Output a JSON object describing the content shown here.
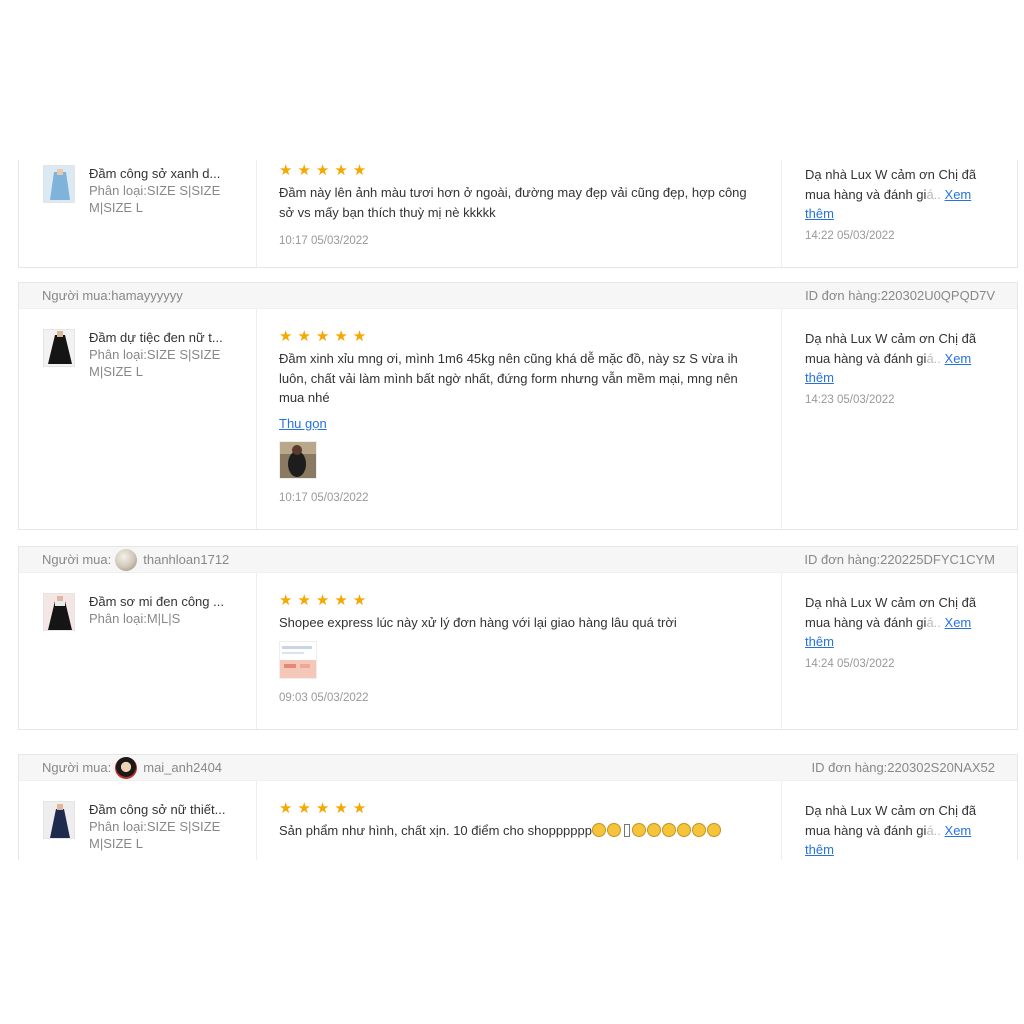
{
  "reviews": [
    {
      "buyer_label": "",
      "buyer_name": "",
      "order_label": "",
      "order_id": "",
      "product_name": "Đầm công sở xanh d...",
      "variant": "Phân loại:SIZE S|SIZE M|SIZE L",
      "stars": "★★★★★",
      "text": "Đầm này lên ảnh màu tươi hơn ở ngoài, đường may đẹp vải cũng đẹp, hợp công sở vs mấy bạn thích thuỳ mị nè kkkkk",
      "review_time": "10:17 05/03/2022",
      "reply": "Dạ nhà Lux W cảm ơn Chị đã mua hàng và đánh gi",
      "reply_fade": "á..",
      "more_label": "Xem thêm",
      "reply_time": "14:22 05/03/2022"
    },
    {
      "buyer_label": "Người mua:",
      "buyer_name": "hamayyyyyy",
      "order_label": "ID đơn hàng:",
      "order_id": "220302U0QPQD7V",
      "product_name": "Đầm dự tiệc đen nữ t...",
      "variant": "Phân loại:SIZE S|SIZE M|SIZE L",
      "stars": "★★★★★",
      "text": "Đầm xinh xỉu mng ơi, mình 1m6 45kg nên cũng khá dễ mặc đồ, này sz S vừa ih luôn, chất vải làm mình bất ngờ nhất, đứng form nhưng vẫn mềm mại, mng nên mua nhé",
      "collapse_label": "Thu gọn",
      "review_time": "10:17 05/03/2022",
      "reply": "Dạ nhà Lux W cảm ơn Chị đã mua hàng và đánh gi",
      "reply_fade": "á..",
      "more_label": "Xem thêm",
      "reply_time": "14:23 05/03/2022"
    },
    {
      "buyer_label": "Người mua:",
      "buyer_name": "thanhloan1712",
      "order_label": "ID đơn hàng:",
      "order_id": "220225DFYC1CYM",
      "product_name": "Đầm sơ mi đen công ...",
      "variant": "Phân loại:M|L|S",
      "stars": "★★★★★",
      "text": "Shopee express lúc này xử lý đơn hàng với lại giao hàng lâu quá trời",
      "review_time": "09:03 05/03/2022",
      "reply": "Dạ nhà Lux W cảm ơn Chị đã mua hàng và đánh gi",
      "reply_fade": "á..",
      "more_label": "Xem thêm",
      "reply_time": "14:24 05/03/2022"
    },
    {
      "buyer_label": "Người mua:",
      "buyer_name": "mai_anh2404",
      "order_label": "ID đơn hàng:",
      "order_id": "220302S20NAX52",
      "product_name": "Đầm công sở nữ thiết...",
      "variant": "Phân loại:SIZE S|SIZE M|SIZE L",
      "stars": "★★★★★",
      "text": "Sản phẩm như hình, chất xịn. 10 điểm cho shopppppp",
      "reply": "Dạ nhà Lux W cảm ơn Chị đã mua hàng và đánh gi",
      "reply_fade": "á..",
      "more_label": "Xem thêm"
    }
  ],
  "colors": {
    "star": "#f6a700",
    "link": "#2673dd",
    "header_bg": "#f6f6f6"
  }
}
